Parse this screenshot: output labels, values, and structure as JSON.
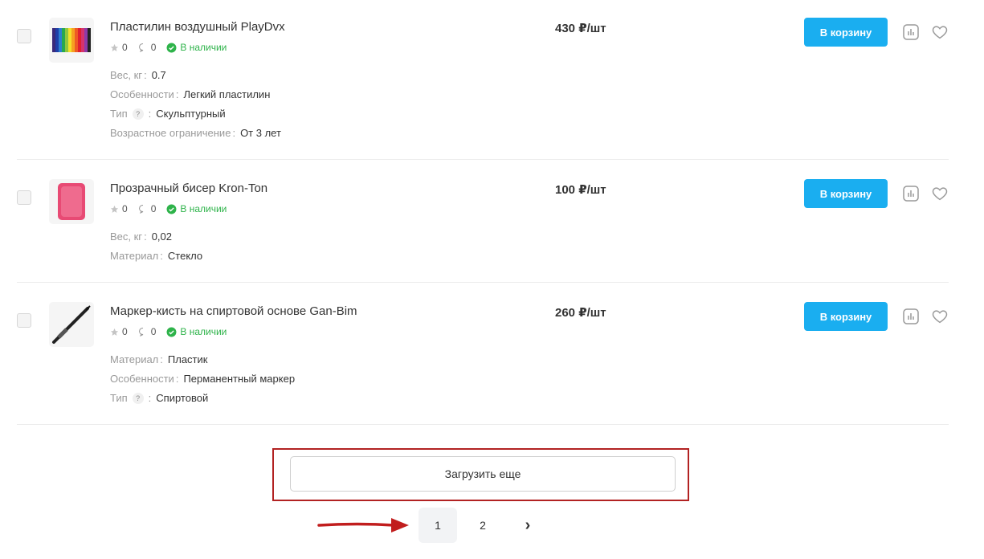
{
  "products": [
    {
      "title": "Пластилин воздушный PlayDvx",
      "rating": "0",
      "reviews": "0",
      "stock": "В наличии",
      "price": "430 ₽/шт",
      "cart_label": "В корзину",
      "props": [
        {
          "key": "Вес, кг",
          "value": "0.7"
        },
        {
          "key": "Особенности",
          "value": "Легкий пластилин"
        },
        {
          "key": "Тип",
          "value": "Скульптурный"
        },
        {
          "key": "Возрастное ограничение",
          "value": "От 3 лет"
        }
      ]
    },
    {
      "title": "Прозрачный бисер Kron-Ton",
      "rating": "0",
      "reviews": "0",
      "stock": "В наличии",
      "price": "100 ₽/шт",
      "cart_label": "В корзину",
      "props": [
        {
          "key": "Вес, кг",
          "value": "0,02"
        },
        {
          "key": "Материал",
          "value": "Стекло"
        }
      ]
    },
    {
      "title": "Маркер-кисть на спиртовой основе Gan-Bim",
      "rating": "0",
      "reviews": "0",
      "stock": "В наличии",
      "price": "260 ₽/шт",
      "cart_label": "В корзину",
      "props": [
        {
          "key": "Материал",
          "value": "Пластик"
        },
        {
          "key": "Особенности",
          "value": "Перманентный маркер"
        },
        {
          "key": "Тип",
          "value": "Спиртовой"
        }
      ]
    }
  ],
  "hint_symbol": "?",
  "load_more_label": "Загрузить еще",
  "pagination": {
    "current": "1",
    "second": "2",
    "next_symbol": "›"
  },
  "colors": {
    "accent": "#1aaef0",
    "in_stock": "#2eb34a",
    "highlight": "#b22222"
  },
  "icons": [
    "star-icon",
    "comment-icon",
    "check-circle-icon",
    "compare-icon",
    "heart-icon",
    "red-arrow"
  ]
}
